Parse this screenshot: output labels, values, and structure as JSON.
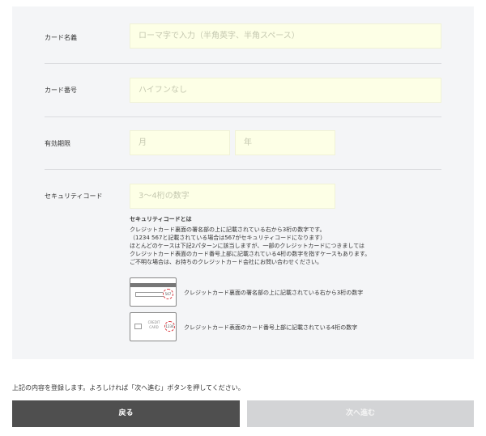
{
  "form": {
    "card_name": {
      "label": "カード名義",
      "placeholder": "ローマ字で入力（半角英字、半角スペース）"
    },
    "card_number": {
      "label": "カード番号",
      "placeholder": "ハイフンなし"
    },
    "expiry": {
      "label": "有効期限",
      "month_placeholder": "月",
      "year_placeholder": "年"
    },
    "security_code": {
      "label": "セキュリティコード",
      "placeholder": "3〜4桁の数字"
    }
  },
  "help": {
    "title": "セキュリティコードとは",
    "lines": [
      "クレジットカード裏面の署名部の上に記載されている右から3桁の数字です。",
      "（1234 567と記載されている場合は567がセキュリティコードになります）",
      "ほとんどのケースは下記2パターンに該当しますが、一部のクレジットカードにつきましては",
      "クレジットカード表面のカード番号上部に記載されている4桁の数字を指すケースもあります。",
      "ご不明な場合は、お持ちのクレジットカード会社にお問い合わせください。"
    ],
    "back_card_code": "567",
    "back_card_desc": "クレジットカード裏面の署名部の上に記載されている右から3桁の数字",
    "front_card_text": "CREDIT CARD",
    "front_card_code": "1234",
    "front_card_desc": "クレジットカード表面のカード番号上部に記載されている4桁の数字"
  },
  "notice": "上記の内容を登録します。よろしければ「次へ進む」ボタンを押してください。",
  "buttons": {
    "back": "戻る",
    "next": "次へ進む"
  },
  "colors": {
    "input_bg": "#fdffe6",
    "panel_bg": "#f4f5f7",
    "back_button": "#4f4f4f",
    "next_button_disabled": "#d3d4d6",
    "code_circle": "#d9383f"
  }
}
